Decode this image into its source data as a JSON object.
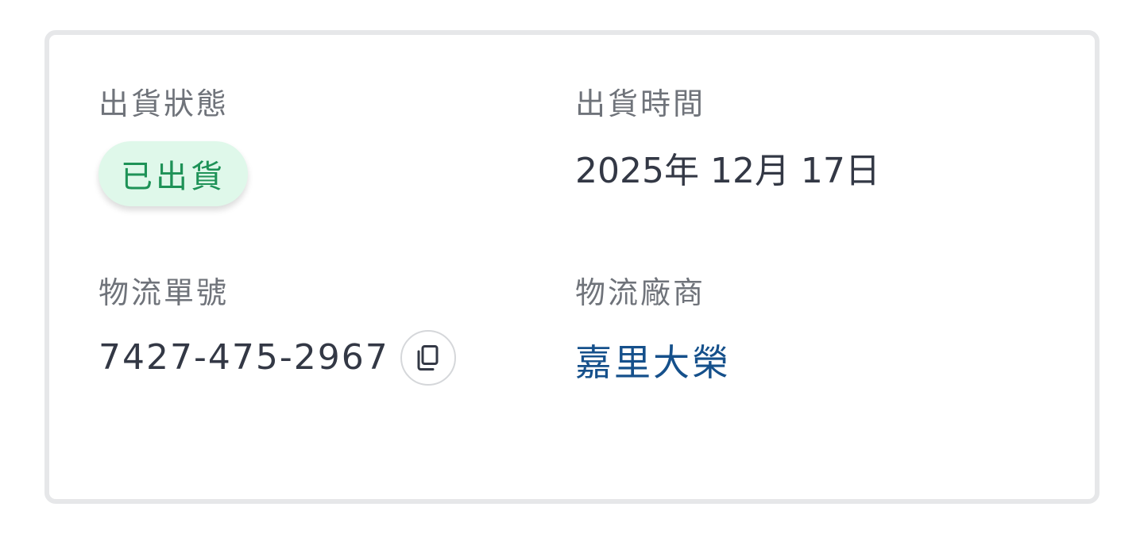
{
  "shipping": {
    "status_label": "出貨狀態",
    "status_value": "已出貨",
    "time_label": "出貨時間",
    "time_value": "2025年 12月 17日",
    "tracking_label": "物流單號",
    "tracking_value": "7427-475-2967",
    "carrier_label": "物流廠商",
    "carrier_value": "嘉里大榮"
  },
  "icons": {
    "copy": "copy-icon"
  },
  "colors": {
    "badge_bg": "#dff8ea",
    "badge_text": "#1e9257",
    "link": "#15508b",
    "label": "#6f737a",
    "value": "#333845",
    "card_border": "#e6e7e9"
  }
}
